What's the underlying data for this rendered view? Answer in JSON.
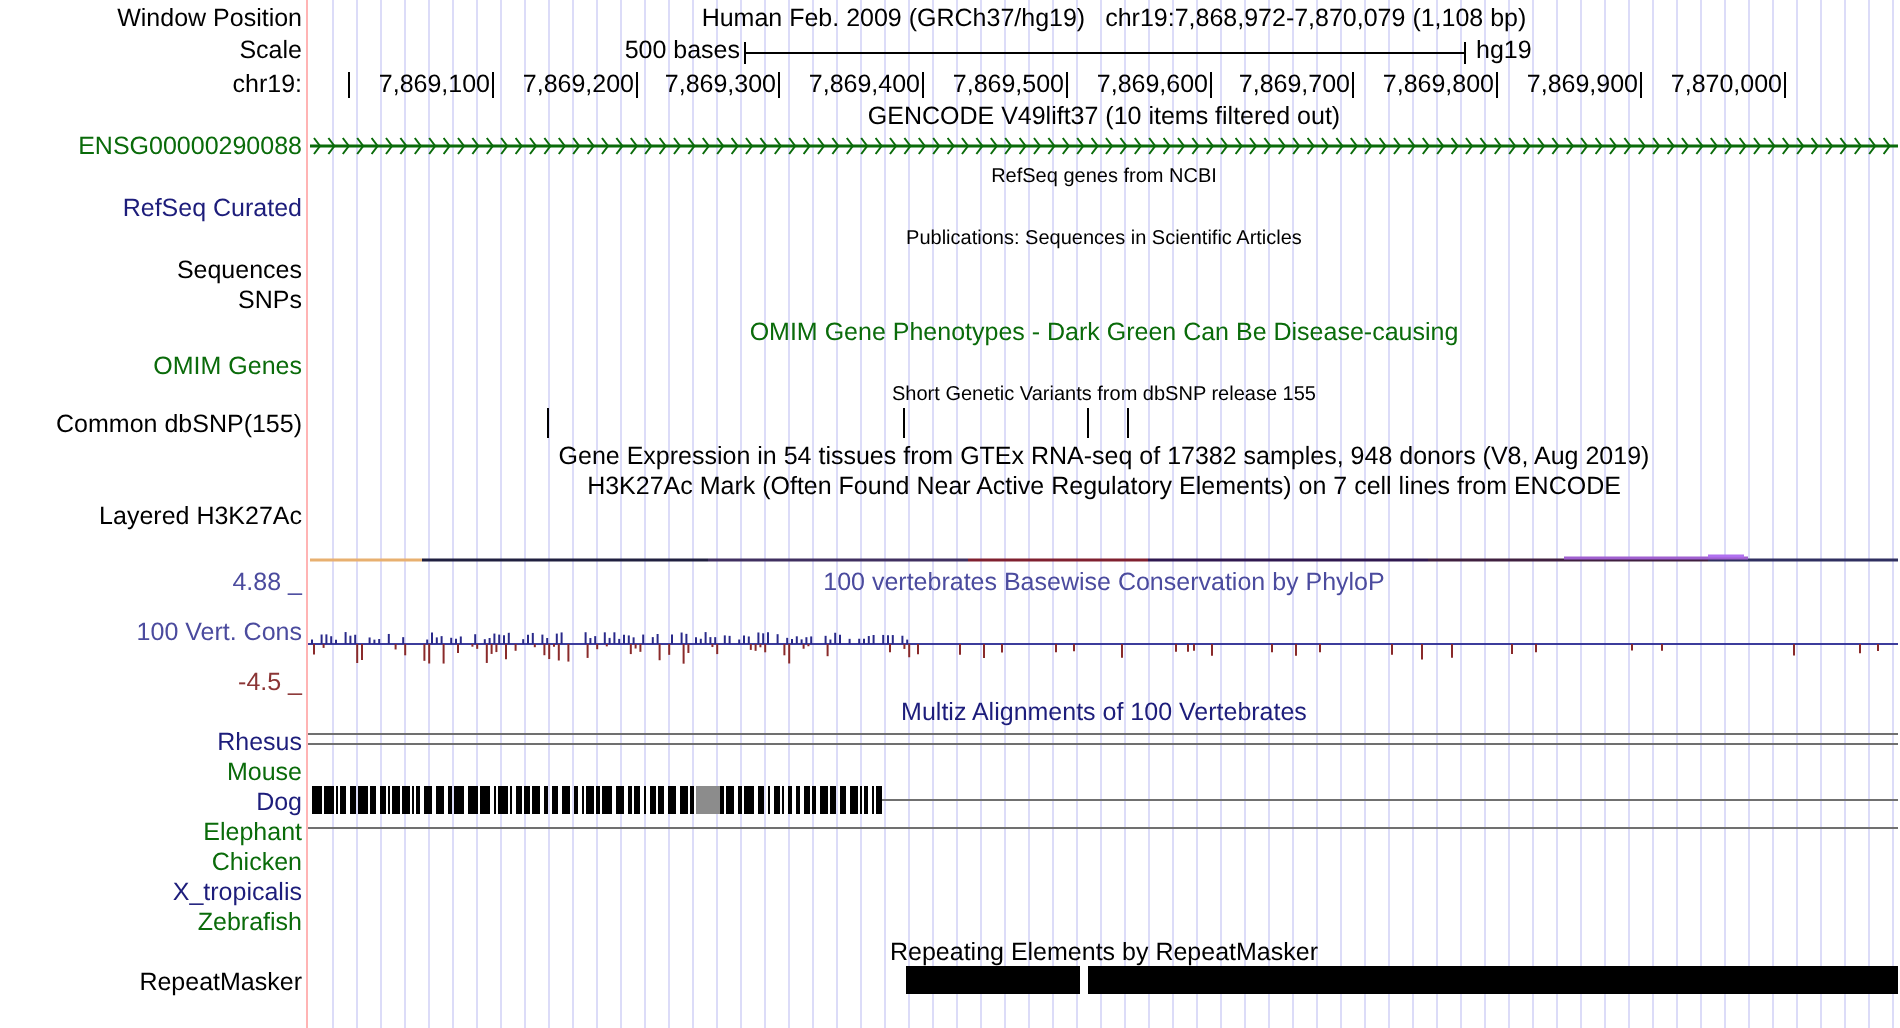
{
  "header": {
    "label": "Window Position",
    "assembly": "Human Feb. 2009 (GRCh37/hg19)",
    "position": "chr19:7,868,972-7,870,079 (1,108 bp)"
  },
  "scale": {
    "label": "Scale",
    "length": "500 bases",
    "assembly": "hg19"
  },
  "ruler": {
    "label": "chr19:",
    "ticks": [
      "7,869,100",
      "7,869,200",
      "7,869,300",
      "7,869,400",
      "7,869,500",
      "7,869,600",
      "7,869,700",
      "7,869,800",
      "7,869,900",
      "7,870,000"
    ]
  },
  "tracks": [
    {
      "kind": "gene",
      "title": "GENCODE V49lift37 (10 items filtered out)",
      "labels": [
        {
          "text": "ENSG00000290088",
          "color": "#0a6b0a"
        }
      ]
    },
    {
      "kind": "note",
      "title": "RefSeq genes from NCBI",
      "labels": [
        {
          "text": "RefSeq Curated",
          "color": "#1d1d7b"
        }
      ]
    },
    {
      "kind": "note",
      "title": "Publications: Sequences in Scientific Articles",
      "labels": [
        {
          "text": "Sequences",
          "color": "#000000"
        },
        {
          "text": "SNPs",
          "color": "#000000"
        }
      ]
    },
    {
      "kind": "phenotype",
      "title": "OMIM Gene Phenotypes - Dark Green Can Be Disease-causing",
      "labels": [
        {
          "text": "OMIM Genes",
          "color": "#0a6b0a"
        }
      ]
    },
    {
      "kind": "snp",
      "title": "Short Genetic Variants from dbSNP release 155",
      "labels": [
        {
          "text": "Common dbSNP(155)",
          "color": "#000000"
        }
      ]
    },
    {
      "kind": "expression",
      "title": "Gene Expression in 54 tissues from GTEx RNA-seq of 17382 samples, 948 donors (V8, Aug 2019)"
    },
    {
      "kind": "signal",
      "title": "H3K27Ac Mark (Often Found Near Active Regulatory Elements) on 7 cell lines from ENCODE",
      "labels": [
        {
          "text": "Layered H3K27Ac",
          "color": "#000000"
        }
      ]
    },
    {
      "kind": "conservation",
      "title": "100 vertebrates Basewise Conservation by PhyloP",
      "max": "4.88 _",
      "min": "-4.5 _",
      "labels": [
        {
          "text": "100 Vert. Cons",
          "color": "#4b4b9e"
        }
      ]
    },
    {
      "kind": "alignment",
      "title": "Multiz Alignments of 100 Vertebrates",
      "species": [
        {
          "name": "Rhesus",
          "color": "#1d1d7b",
          "kind": "double-line"
        },
        {
          "name": "Mouse",
          "color": "#0a6b0a",
          "kind": "none"
        },
        {
          "name": "Dog",
          "color": "#1d1d7b",
          "kind": "blocks"
        },
        {
          "name": "Elephant",
          "color": "#0a6b0a",
          "kind": "line"
        },
        {
          "name": "Chicken",
          "color": "#0a6b0a",
          "kind": "none"
        },
        {
          "name": "X_tropicalis",
          "color": "#1d1d7b",
          "kind": "none"
        },
        {
          "name": "Zebrafish",
          "color": "#0a6b0a",
          "kind": "none"
        }
      ]
    },
    {
      "kind": "repeat",
      "title": "Repeating Elements by RepeatMasker",
      "labels": [
        {
          "text": "RepeatMasker",
          "color": "#000000"
        }
      ]
    }
  ]
}
